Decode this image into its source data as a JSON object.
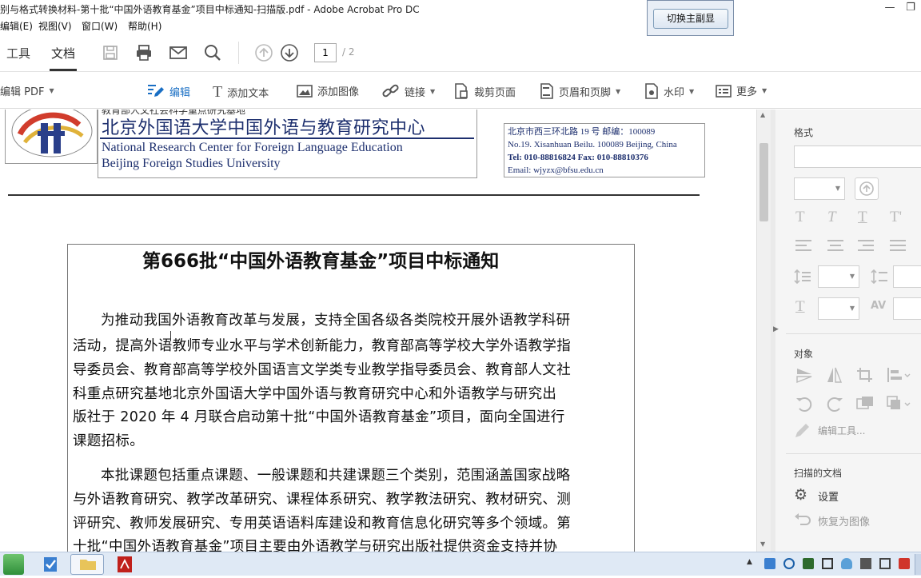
{
  "window": {
    "title": "别与格式转换材料-第十批“中国外语教育基金”项目中标通知-扫描版.pdf - Adobe Acrobat Pro DC"
  },
  "menu": {
    "items": [
      "编辑(E)",
      "视图(V)",
      "窗口(W)",
      "帮助(H)"
    ]
  },
  "switch_window": {
    "button_label": "切换主副显"
  },
  "toolbar": {
    "tabs": [
      "工具",
      "文档"
    ],
    "page_current": "1",
    "page_total": "/ 2"
  },
  "edit_toolbar": {
    "edit_pdf_label": "编辑 PDF",
    "edit": "编辑",
    "add_text": "添加文本",
    "add_image": "添加图像",
    "link": "链接",
    "crop": "裁剪页面",
    "header_footer": "页眉和页脚",
    "watermark": "水印",
    "more": "更多"
  },
  "letterhead": {
    "cn_name": "北京外国语大学中国外语与教育研究中心",
    "top_partial": "教育部人文社会科学重点研究基地",
    "en_line1": "National Research Center for Foreign Language Education",
    "en_line2": "Beijing Foreign Studies University",
    "address_cn": "北京市西三环北路 19 号  邮编：100089",
    "address_en": "No.19. Xisanhuan Beilu. 100089 Beijing, China",
    "tel": "Tel: 010-88816824    Fax: 010-88810376",
    "email": "Email: wjyzx@bfsu.edu.cn"
  },
  "document": {
    "heading": "第666批“中国外语教育基金”项目中标通知",
    "lines": [
      "为推动我国外语教育改革与发展，支持全国各级各类院校开展外语教学科研",
      "活动，提高外语教师专业水平与学术创新能力，教育部高等学校大学外语教学指",
      "导委员会、教育部高等学校外国语言文学类专业教学指导委员会、教育部人文社",
      "科重点研究基地北京外国语大学中国外语与教育研究中心和外语教学与研究出",
      "版社于 2020 年 4 月联合启动第十批“中国外语教育基金”项目，面向全国进行",
      "课题招标。",
      "本批课题包括重点课题、一般课题和共建课题三个类别，范围涵盖国家战略",
      "与外语教育研究、教学改革研究、课程体系研究、教学教法研究、教材研究、测",
      "评研究、教师发展研究、专用英语语料库建设和教育信息化研究等多个领域。第",
      "十批“中国外语教育基金”项目主要由外语教学与研究出版社提供资金支持并协"
    ]
  },
  "right_panel": {
    "format_header": "格式",
    "object_header": "对象",
    "edit_tool": "编辑工具...",
    "scanned_header": "扫描的文档",
    "settings": "设置",
    "restore": "恢复为图像"
  }
}
